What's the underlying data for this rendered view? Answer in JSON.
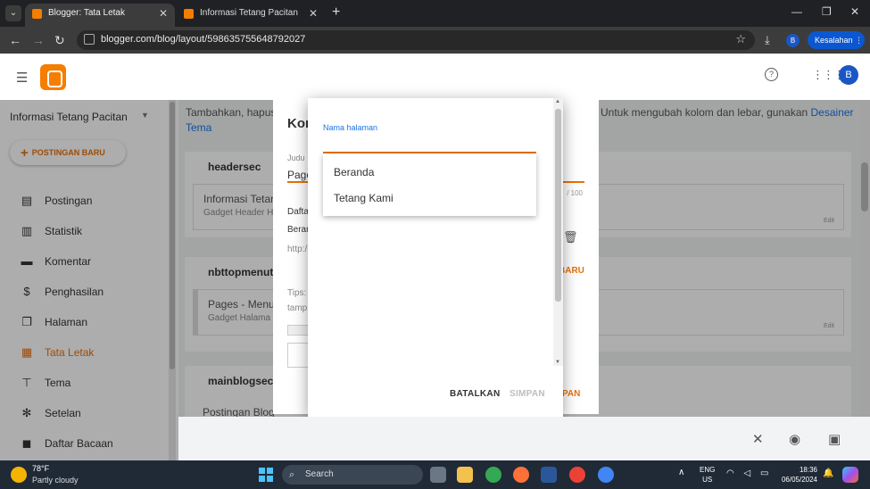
{
  "browser": {
    "tabs": [
      {
        "title": "Blogger: Tata Letak",
        "active": true
      },
      {
        "title": "Informasi Tetang Pacitan",
        "active": false
      }
    ],
    "url": "blogger.com/blog/layout/598635755648792027",
    "profile_initial": "B",
    "error_button": "Kesalahan"
  },
  "app": {
    "avatar_initial": "B",
    "blog_name": "Informasi Tetang Pacitan",
    "new_post_label": "POSTINGAN BARU",
    "nav": [
      {
        "label": "Postingan",
        "icon": "posts-icon",
        "active": false
      },
      {
        "label": "Statistik",
        "icon": "stats-icon",
        "active": false
      },
      {
        "label": "Komentar",
        "icon": "comments-icon",
        "active": false
      },
      {
        "label": "Penghasilan",
        "icon": "dollar-icon",
        "active": false
      },
      {
        "label": "Halaman",
        "icon": "pages-icon",
        "active": false
      },
      {
        "label": "Tata Letak",
        "icon": "layout-icon",
        "active": true
      },
      {
        "label": "Tema",
        "icon": "theme-brush-icon",
        "active": false
      },
      {
        "label": "Setelan",
        "icon": "gear-icon",
        "active": false
      },
      {
        "label": "Daftar Bacaan",
        "icon": "reading-list-icon",
        "active": false
      }
    ]
  },
  "content": {
    "intro_text": "Tambahkan, hapus",
    "intro_text_right": "Untuk mengubah kolom dan lebar, gunakan",
    "intro_link": "Desainer",
    "intro_link_2": "Tema",
    "sections": [
      {
        "title": "headersec",
        "gadget_title": "Informasi Tetan",
        "gadget_sub": "Gadget Header H",
        "edit": "Edit"
      },
      {
        "title": "nbttopmenuto",
        "gadget_title": "Pages - Menu",
        "gadget_sub": "Gadget Halama",
        "edit": "Edit"
      },
      {
        "title": "mainblogsec",
        "gadget_title": "Postingan Blog",
        "gadget_sub": "",
        "edit": ""
      }
    ]
  },
  "bg_dialog": {
    "title": "Kon",
    "judul_label": "Judu",
    "judul_value": "Page",
    "count": "/ 100",
    "daftar_label": "Dafta",
    "item_label": "Beran",
    "url_partial": "http:/",
    "add_partial": "BARU",
    "tips_partial": "Tips:",
    "tamp_partial": "tamp",
    "save_partial": "PAN"
  },
  "dialog": {
    "field_label": "Nama halaman",
    "field_value": "",
    "options": [
      "Beranda",
      "Tetang Kami"
    ],
    "cancel": "BATALKAN",
    "save": "SIMPAN"
  },
  "taskbar": {
    "weather_temp": "78°F",
    "weather_desc": "Partly cloudy",
    "search_label": "Search",
    "lang_top": "ENG",
    "lang_bottom": "US",
    "time": "18:36",
    "date": "06/05/2024"
  },
  "colors": {
    "accent": "#e8710a",
    "link": "#1a73e8",
    "chrome_dark": "#202124"
  }
}
